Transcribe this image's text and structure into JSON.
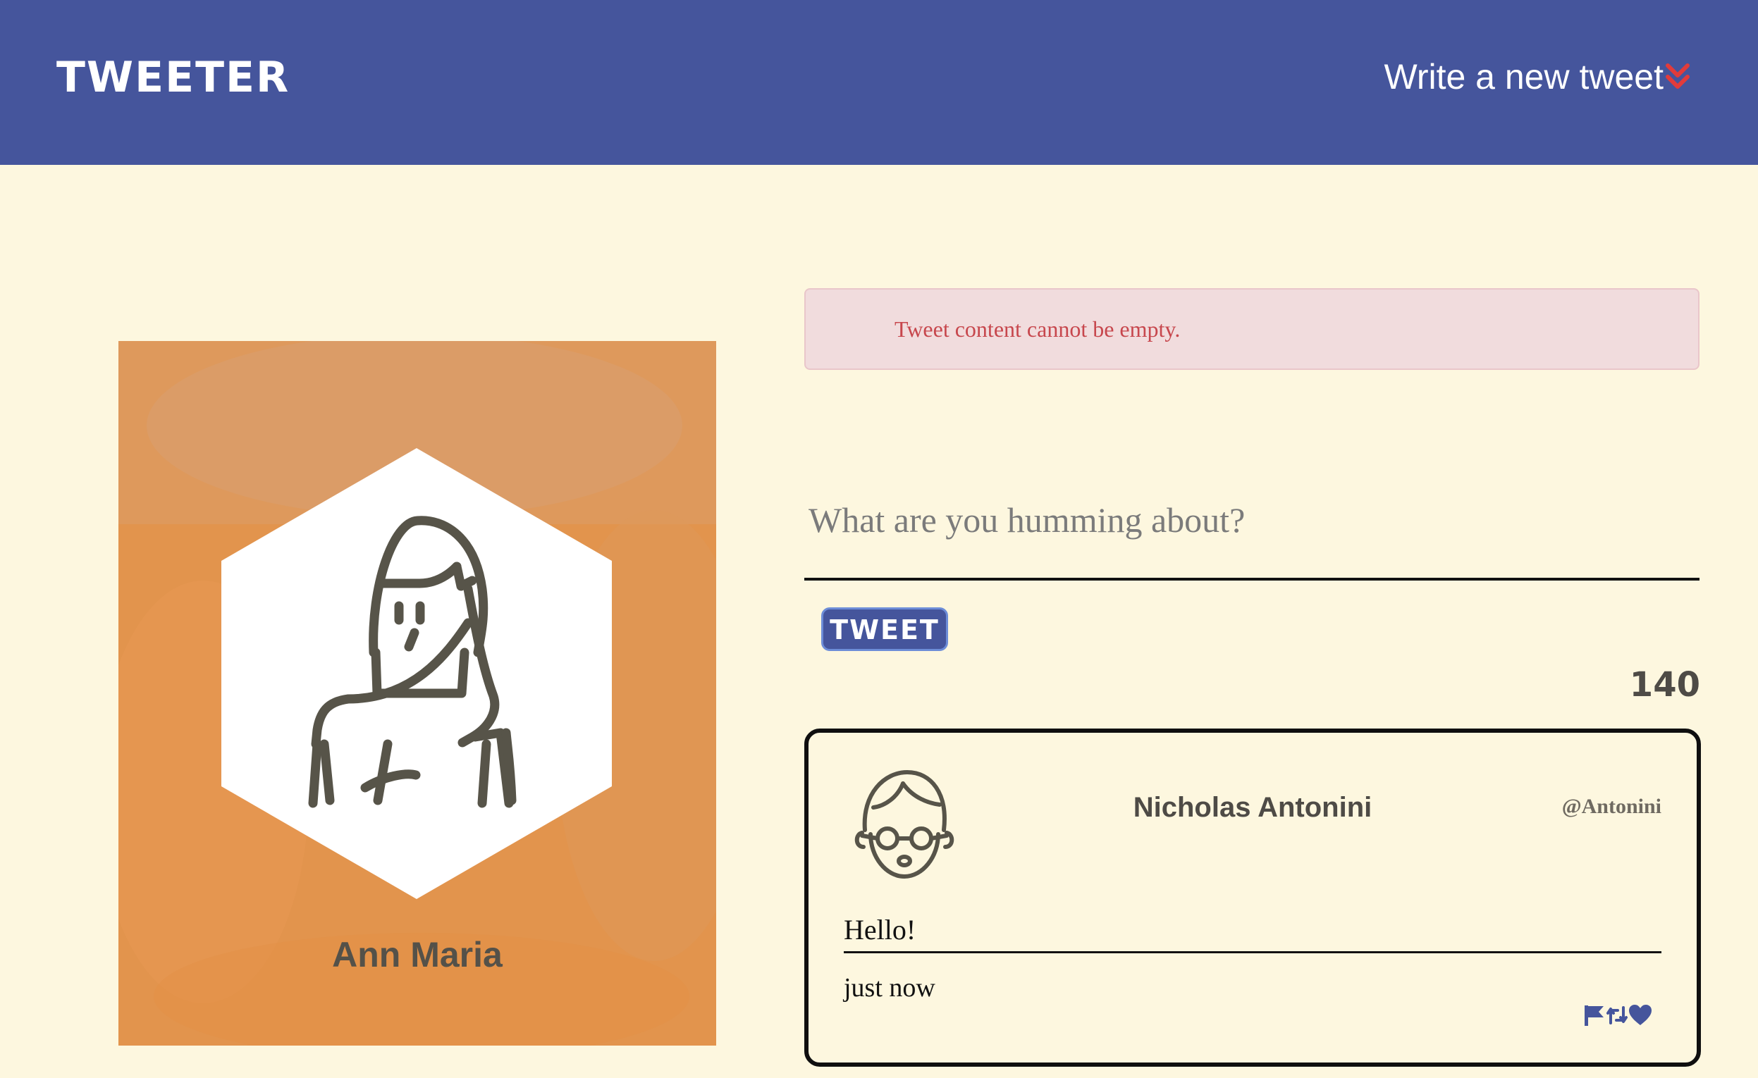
{
  "header": {
    "brand": "TWEETER",
    "compose_toggle_label": "Write a new tweet",
    "compose_toggle_icon": "double-chevron-down-icon",
    "chevron_color": "#E23B3B",
    "background_color": "#45559C"
  },
  "profile": {
    "name": "Ann Maria",
    "card_color": "#E2944D",
    "avatar_icon": "woman-avatar-icon"
  },
  "composer": {
    "error_message": "Tweet content cannot be empty.",
    "placeholder": "What are you humming about?",
    "value": "",
    "submit_label": "TWEET",
    "char_counter": "140"
  },
  "tweets": [
    {
      "author": "Nicholas Antonini",
      "handle": "@Antonini",
      "avatar_icon": "man-glasses-avatar-icon",
      "text": "Hello!",
      "time": "just now",
      "actions": [
        "flag-icon",
        "retweet-icon",
        "heart-icon"
      ]
    }
  ],
  "colors": {
    "page_background": "#FDF7DF",
    "accent": "#45559C",
    "error_text": "#C7474D",
    "error_background": "#F1DCDD"
  }
}
